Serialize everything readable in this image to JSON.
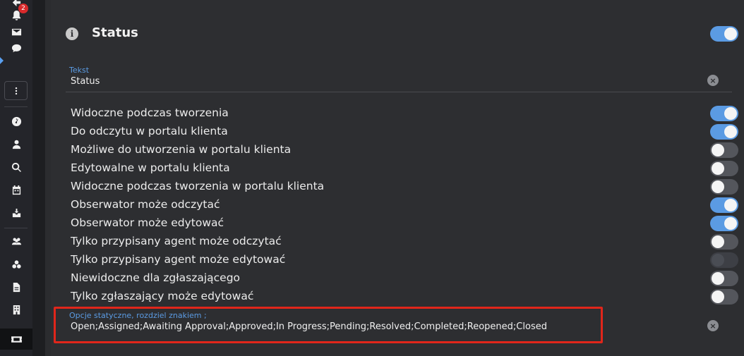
{
  "sidebar": {
    "notification_count": "2",
    "icons": [
      "bell-icon",
      "mail-icon",
      "chat-icon",
      "more-vertical-icon",
      "speedometer-icon",
      "user-icon",
      "search-icon",
      "calendar-icon",
      "inbox-icon",
      "users-icon",
      "groups-icon",
      "document-icon",
      "building-icon",
      "ticket-icon"
    ]
  },
  "header": {
    "title": "Status",
    "toggle_on": true
  },
  "text_field": {
    "label": "Tekst",
    "value": "Status"
  },
  "options": [
    {
      "label": "Widoczne podczas tworzenia",
      "state": "on"
    },
    {
      "label": "Do odczytu w portalu klienta",
      "state": "on"
    },
    {
      "label": "Możliwe do utworzenia w portalu klienta",
      "state": "off"
    },
    {
      "label": "Edytowalne w portalu klienta",
      "state": "off"
    },
    {
      "label": "Widoczne podczas tworzenia w portalu klienta",
      "state": "off"
    },
    {
      "label": "Obserwator może odczytać",
      "state": "on"
    },
    {
      "label": "Obserwator może edytować",
      "state": "on"
    },
    {
      "label": "Tylko przypisany agent może odczytać",
      "state": "off"
    },
    {
      "label": "Tylko przypisany agent może edytować",
      "state": "disabled"
    },
    {
      "label": "Niewidoczne dla zgłaszającego",
      "state": "off"
    },
    {
      "label": "Tylko zgłaszający może edytować",
      "state": "off"
    }
  ],
  "static_options_field": {
    "label": "Opcje statyczne, rozdziel znakiem ;",
    "value": "Open;Assigned;Awaiting Approval;Approved;In Progress;Pending;Resolved;Completed;Reopened;Closed"
  },
  "colors": {
    "accent": "#5b9be3",
    "highlight": "#e0261b",
    "badge": "#d9292b"
  }
}
